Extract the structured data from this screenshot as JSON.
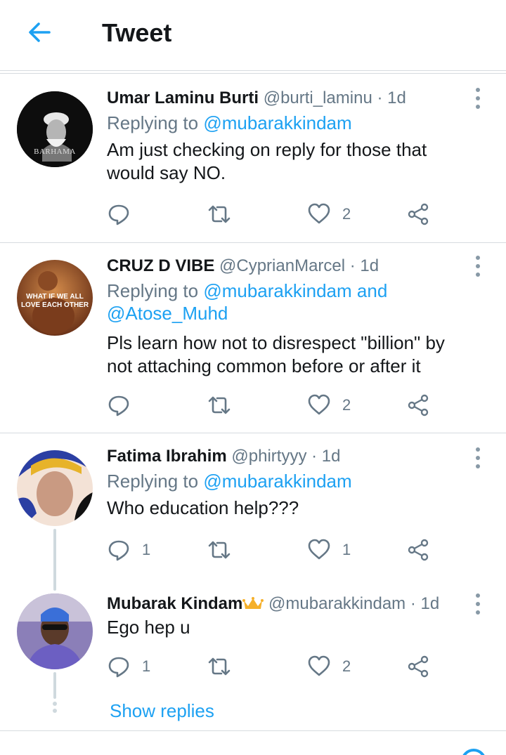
{
  "header": {
    "title": "Tweet",
    "back_icon": "arrow-left-icon",
    "accent": "#1da1f2"
  },
  "tweets": [
    {
      "name": "Umar Laminu Burti",
      "handle": "@burti_laminu",
      "time": "· 1d",
      "reply_prefix": "Replying to ",
      "reply_mentions": "@mubarakkindam",
      "reply_mentions_2": "",
      "text": "Am just checking on reply for those that would say NO.",
      "reply_count": "",
      "like_count": "2",
      "avatar_text": "BARHAMA"
    },
    {
      "name": "CRUZ D VIBE",
      "handle": "@CyprianMarcel",
      "time": "· 1d",
      "reply_prefix": "Replying to ",
      "reply_mentions": "@mubarakkindam and",
      "reply_mentions_2": "@Atose_Muhd",
      "text": "Pls learn how not to disrespect \"billion\" by not attaching common before or after it",
      "reply_count": "",
      "like_count": "2",
      "avatar_text_1": "WHAT IF WE ALL",
      "avatar_text_2": "LOVE EACH OTHER"
    },
    {
      "name": "Fatima Ibrahim",
      "handle": "@phirtyyy",
      "time": "· 1d",
      "reply_prefix": "Replying to ",
      "reply_mentions": "@mubarakkindam",
      "reply_mentions_2": "",
      "text": "Who education help???",
      "reply_count": "1",
      "like_count": "1"
    },
    {
      "name": "Mubarak Kindam",
      "handle": "@mubarakkindam",
      "time": "· 1d",
      "text": "Ego hep u",
      "reply_count": "1",
      "like_count": "2",
      "name_badge_icon": "crown-icon"
    }
  ],
  "show_replies": "Show replies",
  "icons": {
    "reply": "reply-bubble-icon",
    "retweet": "retweet-icon",
    "like": "heart-icon",
    "share": "share-icon",
    "more": "more-vertical-icon"
  }
}
